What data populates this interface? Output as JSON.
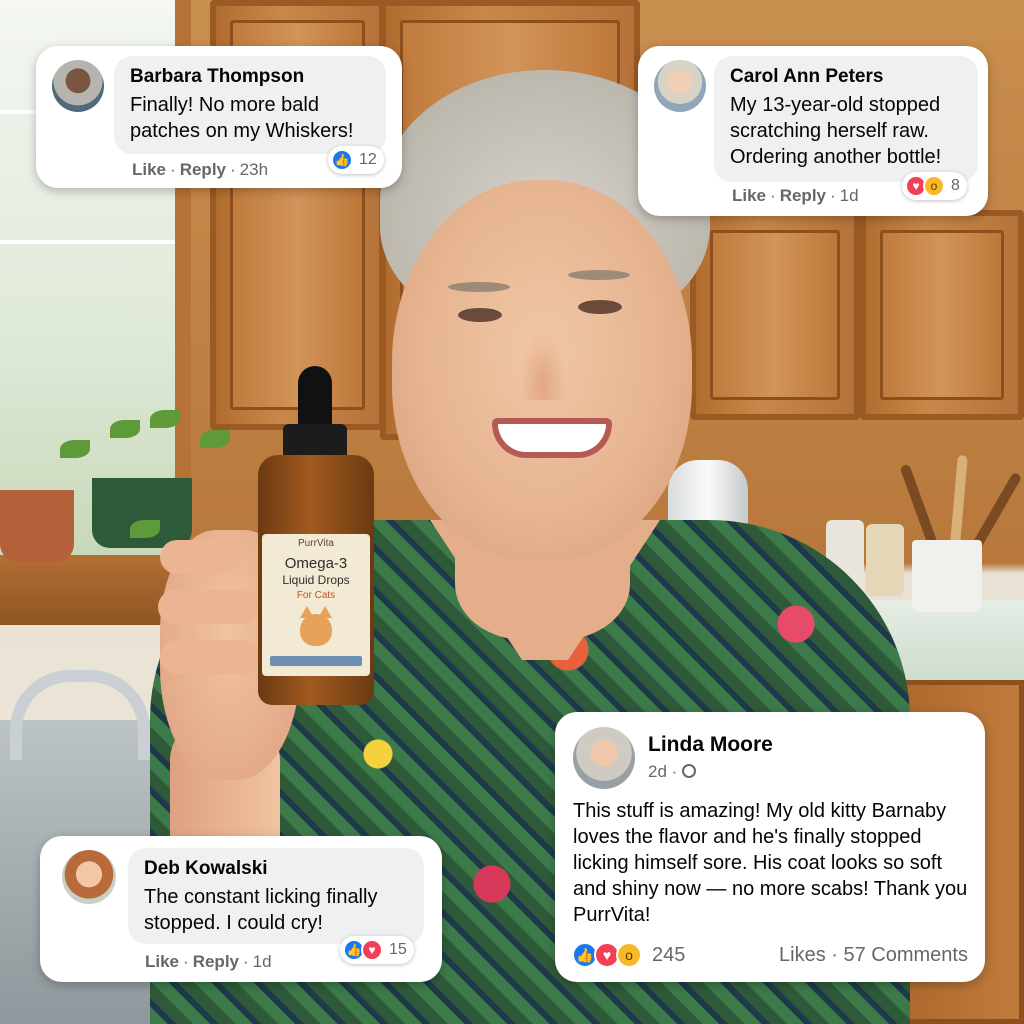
{
  "comments": [
    {
      "name": "Barbara Thompson",
      "text": "Finally! No more bald patches on my Whiskers!",
      "like": "Like",
      "reply": "Reply",
      "time": "23h",
      "reaction_count": "12"
    },
    {
      "name": "Carol Ann Peters",
      "text": "My 13-year-old stopped scratching herself raw. Ordering another bottle!",
      "like": "Like",
      "reply": "Reply",
      "time": "1d",
      "reaction_count": "8"
    },
    {
      "name": "Deb Kowalski",
      "text": "The constant licking finally stopped. I could cry!",
      "like": "Like",
      "reply": "Reply",
      "time": "1d",
      "reaction_count": "15"
    }
  ],
  "post": {
    "name": "Linda Moore",
    "time": "2d ·",
    "text": "This stuff is amazing! My old kitty Barnaby loves the flavor and he's finally stopped licking himself sore. His coat looks so soft and shiny now — no more scabs! Thank you PurrVita!",
    "reaction_count": "245",
    "stats": "Likes · 57 Comments"
  },
  "bottle": {
    "brand": "PurrVita",
    "title": "Omega-3",
    "subtitle": "Liquid Drops",
    "for": "For Cats"
  },
  "icons": {
    "like": "thumbs-up-icon",
    "love": "heart-icon",
    "wow": "wow-face-icon",
    "globe": "globe-icon"
  },
  "colors": {
    "like_blue": "#1877f2",
    "love_red": "#f33e58",
    "wow_yellow": "#f7b928",
    "meta_gray": "#65676b"
  }
}
